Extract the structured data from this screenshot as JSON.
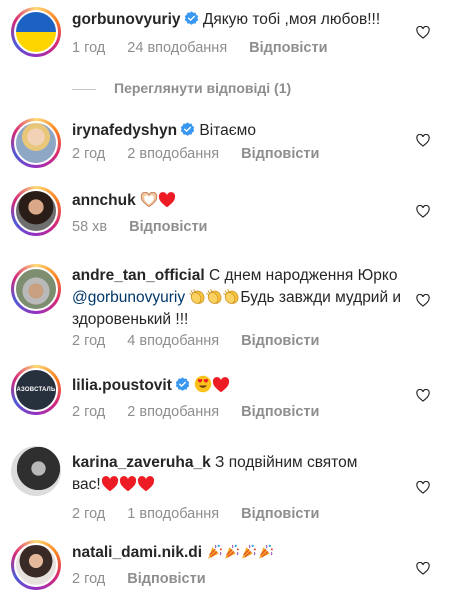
{
  "icons": {
    "like": "heart-outline-icon",
    "verified": "verified-badge-icon"
  },
  "colors": {
    "verified_blue": "#3897f0",
    "meta_gray": "#8e8e8e",
    "mention": "#00376b",
    "heart_red": "#ed1c24"
  },
  "view_replies": "Переглянути відповіді (1)",
  "comments": [
    {
      "username": "gorbunovyuriy",
      "verified": true,
      "text": "Дякую тобі ,моя любов!!!",
      "time": "1 год",
      "likes": "24 вподобання",
      "reply": "Відповісти"
    },
    {
      "username": "irynafedyshyn",
      "verified": true,
      "text": "Вітаємо",
      "time": "2 год",
      "likes": "2 вподобання",
      "reply": "Відповісти"
    },
    {
      "username": "annchuk",
      "verified": false,
      "text": "",
      "emoji": [
        "handheart",
        "heart"
      ],
      "time": "58 хв",
      "reply": "Відповісти"
    },
    {
      "username": "andre_tan_official",
      "verified": false,
      "text": "С днем  народження Юрко",
      "mention": "@gorbunovyuriy",
      "text_after": "Будь завжди мудрий и здоровенький !!!",
      "emoji": [
        "clap",
        "clap",
        "clap"
      ],
      "time": "2 год",
      "likes": "4 вподобання",
      "reply": "Відповісти"
    },
    {
      "username": "lilia.poustovit",
      "verified": true,
      "text": "",
      "emoji": [
        "heart-eyes",
        "heart"
      ],
      "avatar_text": "АЗОВСТАЛЬ",
      "time": "2 год",
      "likes": "2 вподобання",
      "reply": "Відповісти"
    },
    {
      "username": "karina_zaveruha_k",
      "verified": false,
      "text": "З подвійним святом",
      "text2": "вас!",
      "emoji": [
        "heart",
        "heart",
        "heart"
      ],
      "time": "2 год",
      "likes": "1 вподобання",
      "reply": "Відповісти"
    },
    {
      "username": "natali_dami.nik.di",
      "verified": false,
      "text": "",
      "emoji": [
        "party",
        "party",
        "party",
        "party"
      ],
      "time": "2 год",
      "reply": "Відповісти"
    }
  ]
}
